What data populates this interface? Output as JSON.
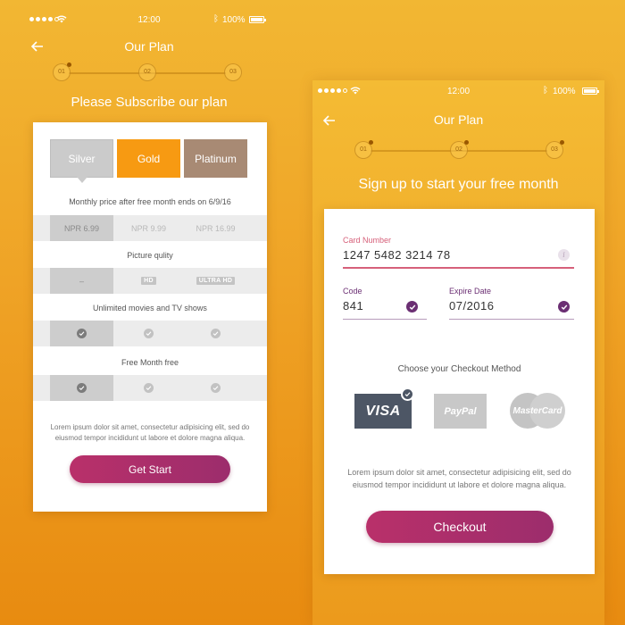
{
  "screen_1": {
    "status_bar": {
      "time": "12:00",
      "battery": "100%"
    },
    "nav": {
      "title": "Our Plan"
    },
    "stepper": {
      "steps": [
        "01",
        "02",
        "03"
      ],
      "active_step": 1
    },
    "heading": "Please Subscribe our plan",
    "plans": {
      "tabs": [
        "Silver",
        "Gold",
        "Platinum"
      ],
      "selected": "Silver",
      "monthly_price_label": "Monthly price after free month ends on 6/9/16",
      "prices": [
        "NPR 6.99",
        "NPR 9.99",
        "NPR 16.99"
      ],
      "picture_quality_label": "Picture qulity",
      "picture_quality": [
        "–",
        "HD",
        "ULTRA HD"
      ],
      "unlimited_label": "Unlimited movies and TV shows",
      "free_month_label": "Free Month free"
    },
    "lorem": [
      "Lorem ipsum dolor sit amet, consectetur adipisicing elit, sed do",
      "eiusmod tempor incididunt ut labore et dolore magna aliqua."
    ],
    "cta_label": "Get Start"
  },
  "screen_2": {
    "status_bar": {
      "time": "12:00",
      "battery": "100%"
    },
    "nav": {
      "title": "Our Plan"
    },
    "stepper": {
      "steps": [
        "01",
        "02",
        "03"
      ]
    },
    "heading": "Sign up to start your free month",
    "card_number": {
      "label": "Card Number",
      "value": "1247 5482 3214 78",
      "info_icon": "i"
    },
    "code": {
      "label": "Code",
      "value": "841"
    },
    "expire_date": {
      "label": "Expire Date",
      "value": "07/2016"
    },
    "checkout_method_label": "Choose your Checkout Method",
    "payment_methods": [
      "VISA",
      "PayPal",
      "MasterCard"
    ],
    "selected_method": "VISA",
    "lorem": [
      "Lorem ipsum dolor sit amet, consectetur adipisicing elit, sed do",
      "eiusmod tempor incididunt ut labore et dolore magna aliqua."
    ],
    "cta_label": "Checkout"
  },
  "colors": {
    "background": "#efa326",
    "gold": "#f79a12",
    "silver": "#cbcbcb",
    "platinum": "#a88a74",
    "button": "#b9306a",
    "card_number_accent": "#d6607a",
    "field_accent": "#6b2f73",
    "visa": "#4d5665"
  },
  "icons": [
    "back-arrow-icon",
    "wifi-icon",
    "bluetooth-icon",
    "battery-icon",
    "check-icon",
    "info-icon"
  ]
}
